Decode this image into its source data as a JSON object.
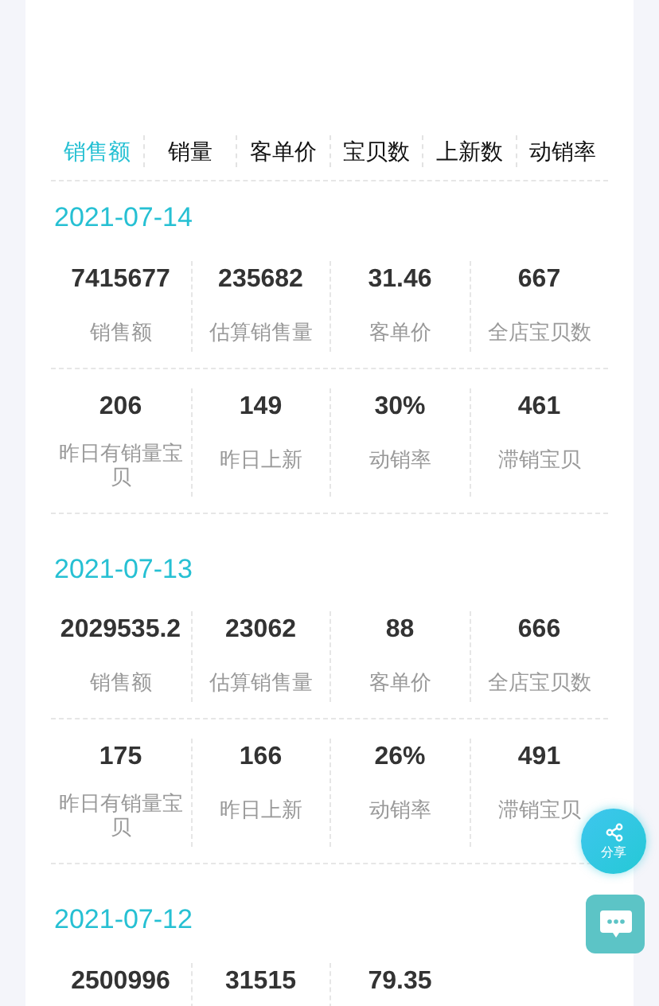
{
  "tabs": [
    {
      "label": "销售额",
      "selected": true
    },
    {
      "label": "销量",
      "selected": false
    },
    {
      "label": "客单价",
      "selected": false
    },
    {
      "label": "宝贝数",
      "selected": false
    },
    {
      "label": "上新数",
      "selected": false
    },
    {
      "label": "动销率",
      "selected": false
    }
  ],
  "days": [
    {
      "date": "2021-07-14",
      "rows": [
        [
          {
            "value": "7415677",
            "label": "销售额"
          },
          {
            "value": "235682",
            "label": "估算销售量"
          },
          {
            "value": "31.46",
            "label": "客单价"
          },
          {
            "value": "667",
            "label": "全店宝贝数"
          }
        ],
        [
          {
            "value": "206",
            "label": "昨日有销量宝贝"
          },
          {
            "value": "149",
            "label": "昨日上新"
          },
          {
            "value": "30%",
            "label": "动销率"
          },
          {
            "value": "461",
            "label": "滞销宝贝"
          }
        ]
      ]
    },
    {
      "date": "2021-07-13",
      "rows": [
        [
          {
            "value": "2029535.2",
            "label": "销售额"
          },
          {
            "value": "23062",
            "label": "估算销售量"
          },
          {
            "value": "88",
            "label": "客单价"
          },
          {
            "value": "666",
            "label": "全店宝贝数"
          }
        ],
        [
          {
            "value": "175",
            "label": "昨日有销量宝贝"
          },
          {
            "value": "166",
            "label": "昨日上新"
          },
          {
            "value": "26%",
            "label": "动销率"
          },
          {
            "value": "491",
            "label": "滞销宝贝"
          }
        ]
      ]
    },
    {
      "date": "2021-07-12",
      "rows": [
        [
          {
            "value": "2500996"
          },
          {
            "value": "31515"
          },
          {
            "value": "79.35"
          }
        ]
      ]
    }
  ],
  "share_button": {
    "label": "分享"
  }
}
